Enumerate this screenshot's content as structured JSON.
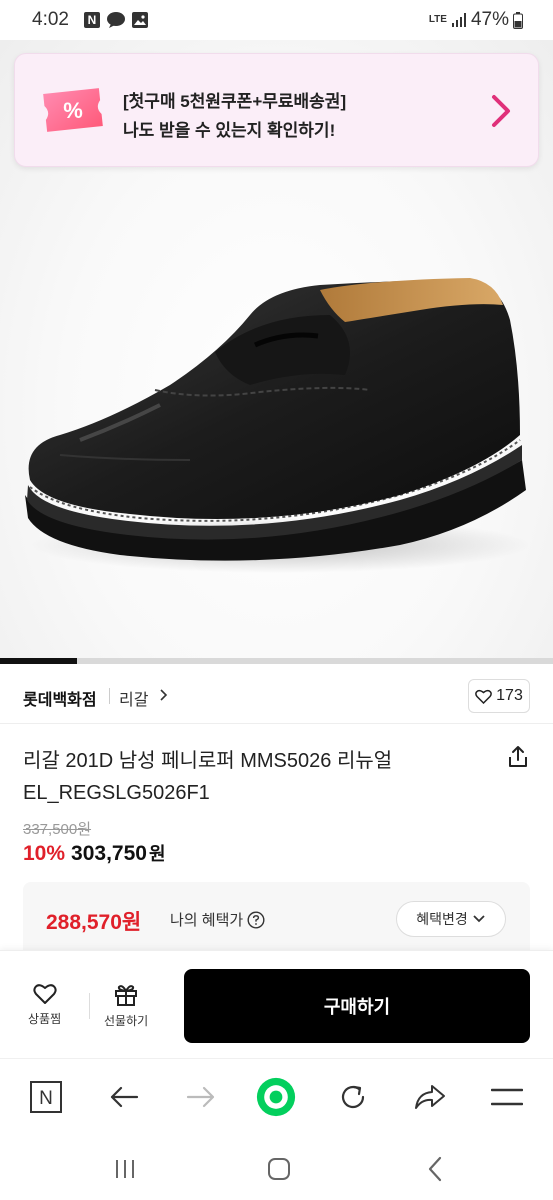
{
  "status_bar": {
    "time": "4:02",
    "network": "LTE",
    "battery": "47%"
  },
  "promo": {
    "line1": "[첫구매 5천원쿠폰+무료배송권]",
    "line2": "나도 받을 수 있는지 확인하기!",
    "ticket_symbol": "%"
  },
  "image_carousel": {
    "progress_fraction": 0.14
  },
  "store": {
    "name": "롯데백화점",
    "brand": "리갈",
    "like_count": "173"
  },
  "product": {
    "title": "리갈 201D 남성 페니로퍼 MMS5026 리뉴얼 EL_REGSLG5026F1",
    "original_price": "337,500원",
    "discount": "10%",
    "sale_price": "303,750",
    "sale_unit": "원"
  },
  "benefit": {
    "price": "288,570원",
    "label": "나의 혜택가",
    "change_button": "혜택변경"
  },
  "actions": {
    "wish_label": "상품찜",
    "gift_label": "선물하기",
    "buy_label": "구매하기"
  },
  "browser_toolbar": {
    "home_label": "N"
  },
  "icons": [
    "notification-n-icon",
    "messenger-icon",
    "gallery-icon",
    "signal-icon",
    "battery-icon",
    "coupon-ticket-icon",
    "chevron-right-icon",
    "heart-icon",
    "share-icon",
    "help-icon",
    "chevron-down-icon",
    "gift-icon",
    "back-arrow-icon",
    "forward-arrow-icon",
    "home-circle-icon",
    "reload-icon",
    "share-arrow-icon",
    "menu-icon",
    "recent-apps-icon",
    "home-icon",
    "back-icon"
  ],
  "colors": {
    "accent_red": "#e0202a",
    "promo_bg": "#fbeef8",
    "buy_button": "#000000",
    "naver_green": "#03cf5d"
  }
}
